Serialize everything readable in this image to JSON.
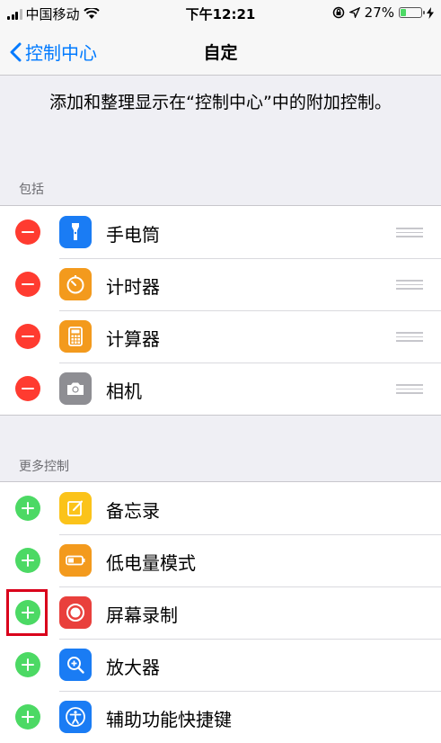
{
  "status_bar": {
    "carrier": "中国移动",
    "time": "下午12:21",
    "battery": "27%",
    "battery_level": 0.27,
    "icons": [
      "signal-icon",
      "wifi-icon",
      "orientation-lock-icon",
      "location-icon",
      "battery-icon",
      "charging-icon"
    ]
  },
  "nav": {
    "back_label": "控制中心",
    "title": "自定"
  },
  "description": "添加和整理显示在“控制中心”中的附加控制。",
  "included": {
    "header": "包括",
    "items": [
      {
        "label": "手电筒",
        "icon": "flashlight-icon",
        "color": "#1a7cf4"
      },
      {
        "label": "计时器",
        "icon": "timer-icon",
        "color": "#f39a1d"
      },
      {
        "label": "计算器",
        "icon": "calculator-icon",
        "color": "#f39a1d"
      },
      {
        "label": "相机",
        "icon": "camera-icon",
        "color": "#8e8e93"
      }
    ]
  },
  "more": {
    "header": "更多控制",
    "items": [
      {
        "label": "备忘录",
        "icon": "notes-icon",
        "color": "#fbc31a"
      },
      {
        "label": "低电量模式",
        "icon": "low-power-icon",
        "color": "#f39a1d"
      },
      {
        "label": "屏幕录制",
        "icon": "screen-record-icon",
        "color": "#e9403c"
      },
      {
        "label": "放大器",
        "icon": "magnifier-icon",
        "color": "#1a7cf4"
      },
      {
        "label": "辅助功能快捷键",
        "icon": "accessibility-icon",
        "color": "#1a7cf4"
      }
    ]
  },
  "colors": {
    "remove": "#ff3b30",
    "add": "#4cd964",
    "accent": "#007aff",
    "highlight": "#d9001b"
  }
}
